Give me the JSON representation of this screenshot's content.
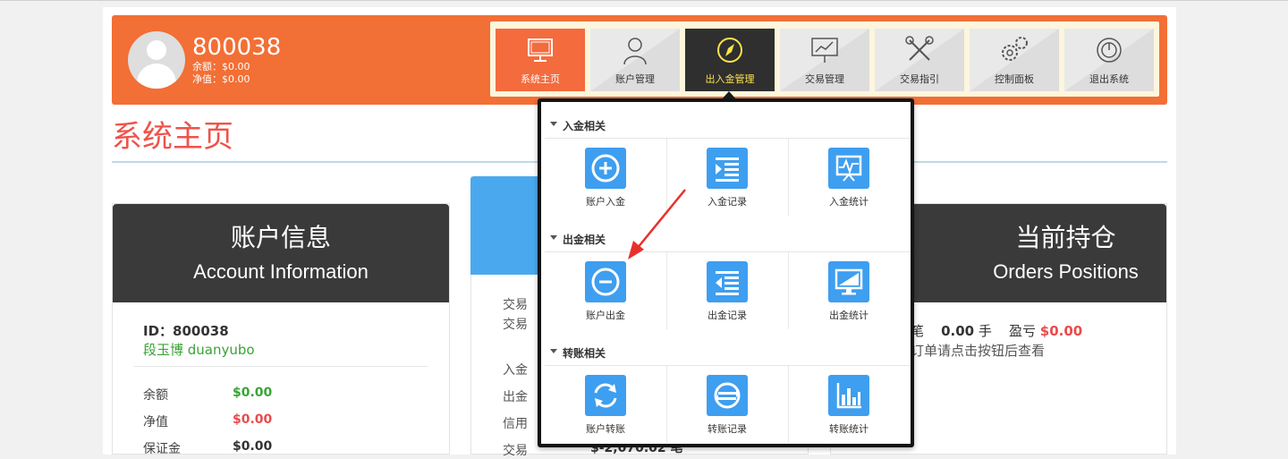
{
  "user": {
    "id": "800038",
    "balance_line": "余额：$0.00",
    "equity_line": "净值：$0.00"
  },
  "nav": [
    {
      "label": "系统主页",
      "icon": "monitor-icon",
      "state": "active"
    },
    {
      "label": "账户管理",
      "icon": "user-icon",
      "state": "normal"
    },
    {
      "label": "出入金管理",
      "icon": "compass-icon",
      "state": "selected"
    },
    {
      "label": "交易管理",
      "icon": "chart-board-icon",
      "state": "normal"
    },
    {
      "label": "交易指引",
      "icon": "tools-icon",
      "state": "normal"
    },
    {
      "label": "控制面板",
      "icon": "gears-icon",
      "state": "normal"
    },
    {
      "label": "退出系统",
      "icon": "power-icon",
      "state": "normal"
    }
  ],
  "page_title": "系统主页",
  "account_panel": {
    "title_zh": "账户信息",
    "title_en": "Account Information",
    "id_line": "ID：800038",
    "name_line": "段玉博 duanyubo",
    "rows": [
      {
        "label": "余额",
        "value": "$0.00",
        "color": "#3aa336"
      },
      {
        "label": "净值",
        "value": "$0.00",
        "color": "#e94b4b"
      },
      {
        "label": "保证金",
        "value": "$0.00",
        "color": "#333333"
      }
    ]
  },
  "middle_panel": {
    "lines": [
      "交易",
      "交易",
      "入金",
      "出金",
      "信用",
      "交易"
    ],
    "partial_value": "$-2,070.02 笔"
  },
  "orders_panel": {
    "title_zh": "当前持仓",
    "title_en": "Orders Positions",
    "summary": {
      "prefix": "笔",
      "lots": "0.00",
      "lots_unit": "手",
      "pl_label": "盈亏",
      "pl_value": "$0.00",
      "pl_color": "#e94b4b"
    },
    "hint": "订单请点击按钮后查看"
  },
  "dropdown": {
    "sections": [
      {
        "title": "入金相关",
        "items": [
          {
            "label": "账户入金",
            "icon": "plus-circle-icon"
          },
          {
            "label": "入金记录",
            "icon": "indent-list-icon"
          },
          {
            "label": "入金统计",
            "icon": "pulse-chart-icon"
          }
        ]
      },
      {
        "title": "出金相关",
        "items": [
          {
            "label": "账户出金",
            "icon": "minus-circle-icon"
          },
          {
            "label": "出金记录",
            "icon": "outdent-list-icon"
          },
          {
            "label": "出金统计",
            "icon": "monitor-icon"
          }
        ]
      },
      {
        "title": "转账相关",
        "items": [
          {
            "label": "账户转账",
            "icon": "refresh-icon"
          },
          {
            "label": "转账记录",
            "icon": "transfer-record-icon"
          },
          {
            "label": "转账统计",
            "icon": "bar-chart-icon"
          }
        ]
      }
    ]
  },
  "colors": {
    "header_orange": "#f26f35",
    "tile_blue": "#3e9ef0",
    "title_red": "#f0524a"
  }
}
